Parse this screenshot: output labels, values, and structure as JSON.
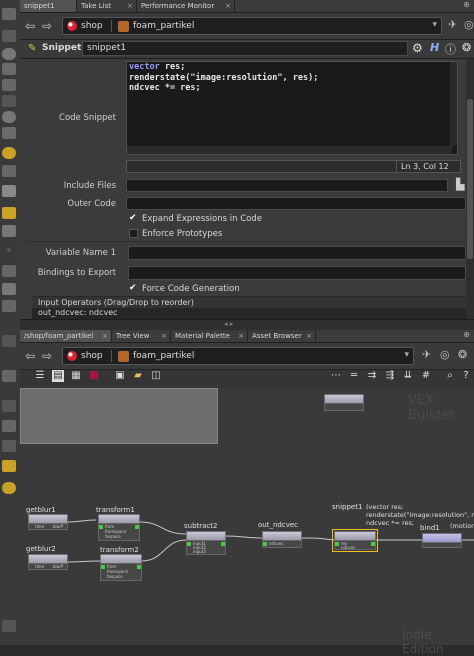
{
  "top_tabs": [
    {
      "label": "snippet1",
      "active": true
    },
    {
      "label": "Take List",
      "active": false
    },
    {
      "label": "Performance Monitor",
      "active": false
    }
  ],
  "top_path": {
    "root": "shop",
    "node": "foam_partikel"
  },
  "parm_header": {
    "type": "Snippet",
    "name": "snippet1"
  },
  "code_snippet": {
    "label": "Code Snippet",
    "lines": [
      "vector res;",
      "renderstate(\"image:resolution\", res);",
      "ndcvec *= res;"
    ],
    "status": "Ln 3, Col 12"
  },
  "parms": {
    "include_files_label": "Include Files",
    "include_files_value": "",
    "outer_code_label": "Outer Code",
    "outer_code_value": "",
    "expand_expressions_label": "Expand Expressions in Code",
    "expand_expressions_checked": true,
    "enforce_prototypes_label": "Enforce Prototypes",
    "enforce_prototypes_checked": false,
    "variable_name_label": "Variable Name 1",
    "variable_name_value": "",
    "bindings_label": "Bindings to Export",
    "bindings_value": "",
    "force_codegen_label": "Force Code Generation",
    "force_codegen_checked": true,
    "input_operators_label": "Input Operators (Drag/Drop to reorder)",
    "input_operator_item": "out_ndcvec: ndcvec"
  },
  "net_tabs": [
    {
      "label": "/shop/foam_partikel",
      "active": true
    },
    {
      "label": "Tree View",
      "active": false
    },
    {
      "label": "Material Palette",
      "active": false
    },
    {
      "label": "Asset Browser",
      "active": false
    }
  ],
  "net_path": {
    "root": "shop",
    "node": "foam_partikel"
  },
  "network": {
    "watermark_context": "VEX Builder",
    "watermark_edition": "Indie Edition",
    "nodes": [
      {
        "name": "getblur1",
        "inputs": [
          "time",
          "blurP"
        ]
      },
      {
        "name": "getblur2",
        "inputs": [
          "time",
          "blurP"
        ]
      },
      {
        "name": "transform1",
        "inputs": [
          "from",
          "fromspace",
          "tospace"
        ]
      },
      {
        "name": "transform2",
        "inputs": [
          "from",
          "fromspace",
          "tospace"
        ]
      },
      {
        "name": "subtract2",
        "inputs": [
          "input1",
          "input2",
          "input3"
        ]
      },
      {
        "name": "out_ndcvec",
        "inputs": [
          "ndcvec"
        ]
      },
      {
        "name": "snippet1",
        "inputs": [
          "res",
          "ndcvec"
        ],
        "comment": "(vector res;\nrenderstate(\"image:resolution\", res;\nndcvec *= res;"
      },
      {
        "name": "bind1",
        "inputs": [],
        "comment": "(motion"
      }
    ]
  },
  "colors": {
    "accent_selected": "#f0c020",
    "node_header": "#b8b8c8",
    "background": "#2b2b2b"
  }
}
